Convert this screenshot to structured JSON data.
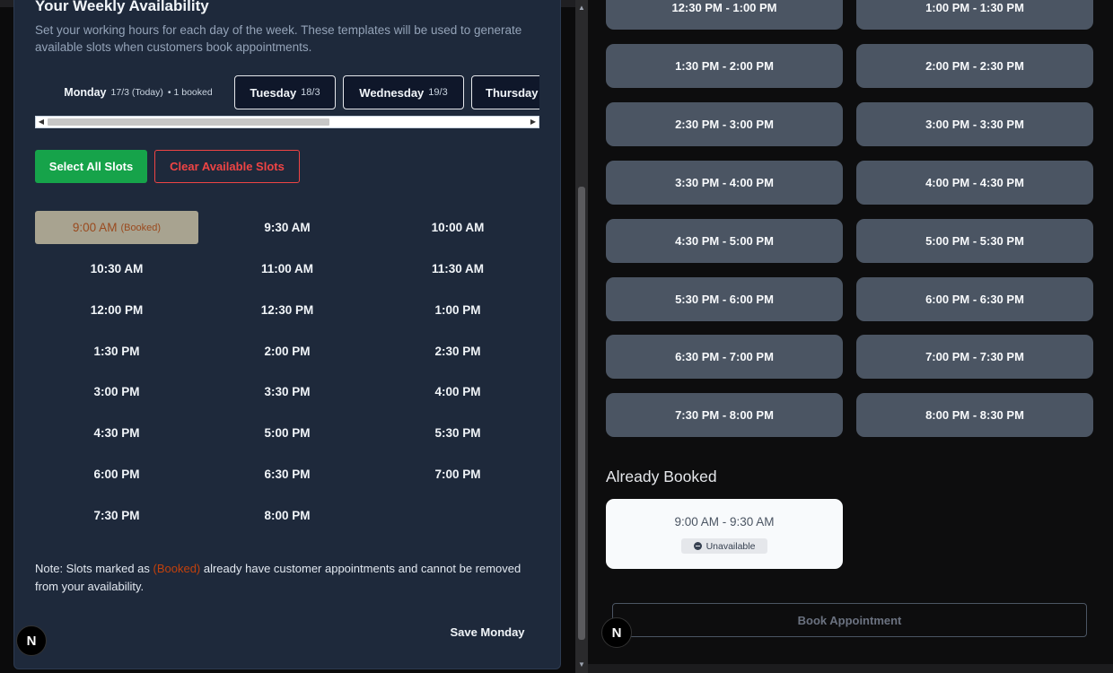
{
  "availability": {
    "title": "Your Weekly Availability",
    "subtitle": "Set your working hours for each day of the week. These templates will be used to generate available slots when customers book appointments.",
    "tabs": [
      {
        "day": "Monday",
        "date": "17/3 (Today)",
        "extra": "• 1 booked",
        "active": true
      },
      {
        "day": "Tuesday",
        "date": "18/3",
        "active": false
      },
      {
        "day": "Wednesday",
        "date": "19/3",
        "active": false
      },
      {
        "day": "Thursday",
        "date": "",
        "active": false
      }
    ],
    "select_all_label": "Select All Slots",
    "clear_label": "Clear Available Slots",
    "slots": [
      {
        "time": "9:00 AM",
        "tag": "(Booked)",
        "booked": true
      },
      {
        "time": "9:30 AM"
      },
      {
        "time": "10:00 AM"
      },
      {
        "time": "10:30 AM"
      },
      {
        "time": "11:00 AM"
      },
      {
        "time": "11:30 AM"
      },
      {
        "time": "12:00 PM"
      },
      {
        "time": "12:30 PM"
      },
      {
        "time": "1:00 PM"
      },
      {
        "time": "1:30 PM"
      },
      {
        "time": "2:00 PM"
      },
      {
        "time": "2:30 PM"
      },
      {
        "time": "3:00 PM"
      },
      {
        "time": "3:30 PM"
      },
      {
        "time": "4:00 PM"
      },
      {
        "time": "4:30 PM"
      },
      {
        "time": "5:00 PM"
      },
      {
        "time": "5:30 PM"
      },
      {
        "time": "6:00 PM"
      },
      {
        "time": "6:30 PM"
      },
      {
        "time": "7:00 PM"
      },
      {
        "time": "7:30 PM"
      },
      {
        "time": "8:00 PM"
      }
    ],
    "note_prefix": "Note: Slots marked as ",
    "note_highlight": "(Booked)",
    "note_suffix": " already have customer appointments and cannot be removed from your availability.",
    "save_label": "Save Monday"
  },
  "booking": {
    "slots": [
      "12:30 PM - 1:00 PM",
      "1:00 PM - 1:30 PM",
      "1:30 PM - 2:00 PM",
      "2:00 PM - 2:30 PM",
      "2:30 PM - 3:00 PM",
      "3:00 PM - 3:30 PM",
      "3:30 PM - 4:00 PM",
      "4:00 PM - 4:30 PM",
      "4:30 PM - 5:00 PM",
      "5:00 PM - 5:30 PM",
      "5:30 PM - 6:00 PM",
      "6:00 PM - 6:30 PM",
      "6:30 PM - 7:00 PM",
      "7:00 PM - 7:30 PM",
      "7:30 PM - 8:00 PM",
      "8:00 PM - 8:30 PM"
    ],
    "already_booked_heading": "Already Booked",
    "booked_slot": "9:00 AM - 9:30 AM",
    "booked_status": "Unavailable",
    "book_button_label": "Book Appointment"
  },
  "badge_letter": "N",
  "colors": {
    "card_bg": "#1e293b",
    "select_all": "#16a34a",
    "clear": "#ef4444",
    "booked_slot_bg": "#a8a390",
    "slot_card_bg": "#4b5563"
  }
}
